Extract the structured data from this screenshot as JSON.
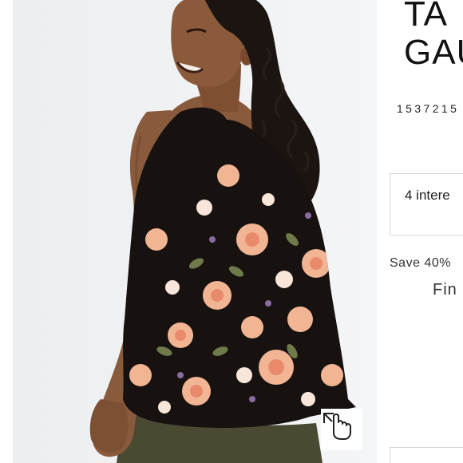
{
  "product": {
    "title_line1": "TA",
    "title_line2": "GAU",
    "code": "1537215",
    "interest": "4 intere",
    "offer": "Save 40%",
    "offer_link": "Fin"
  },
  "image": {
    "alt": "model-wearing-floral-tank-top"
  },
  "controls": {
    "zoom_icon": "expand-hand-cursor-icon"
  },
  "colors": {
    "background": "#f1f2f4",
    "print_base": "#17120f",
    "bloom_peach": "#f2b594",
    "bloom_coral": "#e98a6c",
    "pants": "#4a4a32"
  }
}
